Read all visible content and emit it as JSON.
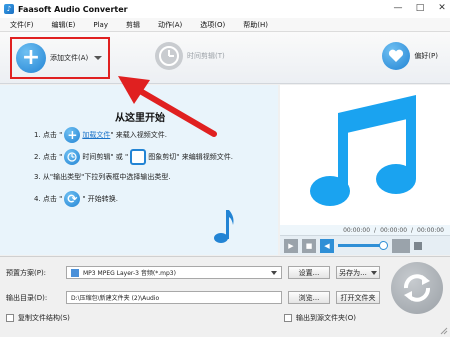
{
  "window": {
    "title": "Faasoft Audio Converter",
    "controls": [
      "—",
      "□",
      "✕"
    ]
  },
  "menu": [
    "文件(F)",
    "编辑(E)",
    "Play",
    "剪辑",
    "动作(A)",
    "选项(O)",
    "帮助(H)"
  ],
  "toolbar": {
    "add_label": "添加文件(A)",
    "clip_label": "时间剪辑(T)",
    "pref_label": "偏好(P)"
  },
  "guide": {
    "title": "从这里开始",
    "step1_prefix": "1. 点击 \"",
    "step1_link": "加载文件",
    "step1_suffix": "\" 来载入视频文件.",
    "step2_prefix": "2. 点击 \"",
    "step2_mid": "时间剪辑",
    "step2_or": "\" 或 \"",
    "step2_end": "图象剪切",
    "step2_suffix": "\" 来编辑视频文件.",
    "step3": "3. 从\"输出类型\"下拉列表框中选择输出类型.",
    "step4_prefix": "4. 点击 \"",
    "step4_suffix": "\" 开始转换."
  },
  "preview": {
    "time_current": "00:00:00",
    "time_mid": "00:00:00",
    "time_total": "00:00:00"
  },
  "bottom": {
    "profile_label": "预置方案(P):",
    "profile_value": "MP3 MPEG Layer-3 音频(*.mp3)",
    "settings_button": "设置...",
    "save_as_button": "另存为...",
    "output_label": "输出目录(D):",
    "output_path": "D:\\压缩包\\新建文件夹 (2)\\Audio",
    "browse_button": "浏览...",
    "open_folder_button": "打开文件夹",
    "copy_structure_label": "复制文件结构(S)",
    "output_source_label": "输出到源文件夹(O)"
  },
  "colors": {
    "accent_blue": "#2384d4",
    "highlight_red": "#e02020",
    "guide_bg": "#e9f4fb"
  }
}
